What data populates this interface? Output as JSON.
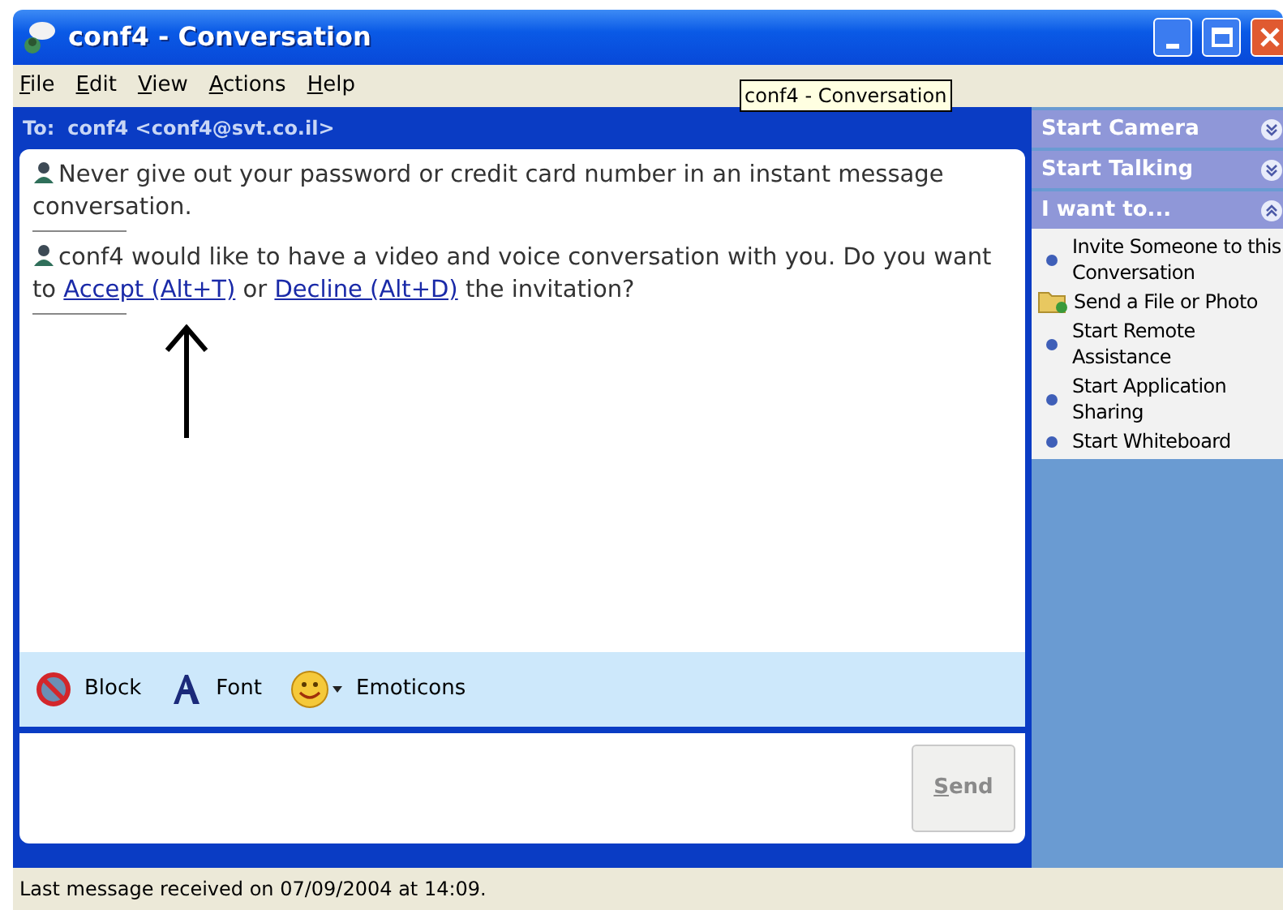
{
  "window": {
    "title": "conf4 - Conversation"
  },
  "menu": [
    {
      "key": "F",
      "rest": "ile"
    },
    {
      "key": "E",
      "rest": "dit"
    },
    {
      "key": "V",
      "rest": "iew"
    },
    {
      "key": "A",
      "rest": "ctions"
    },
    {
      "key": "H",
      "rest": "elp"
    }
  ],
  "tooltip": "conf4 - Conversation",
  "to": {
    "label": "To:",
    "contact": "conf4 <conf4@svt.co.il>"
  },
  "messages": [
    {
      "kind": "warning",
      "text": "Never give out your password or credit card number in an instant message conversation."
    },
    {
      "kind": "invite",
      "before": "conf4 would like to have a video and voice conversation with you. Do you want to",
      "accept": "Accept (Alt+T)",
      "middle": "or",
      "decline": "Decline (Alt+D)",
      "after": "the invitation?"
    }
  ],
  "toolbar": [
    {
      "kind": "block",
      "label": "Block"
    },
    {
      "kind": "font",
      "label": "Font"
    },
    {
      "kind": "emoticons",
      "label": "Emoticons"
    }
  ],
  "send_button": {
    "key": "S",
    "rest": "end",
    "disabled": true
  },
  "side_panel": [
    {
      "title": "Start Camera",
      "expanded": false
    },
    {
      "title": "Start Talking",
      "expanded": false
    },
    {
      "title": "I want to...",
      "expanded": true,
      "items": [
        {
          "kind": "bullet",
          "label": "Invite Someone to this Conversation"
        },
        {
          "kind": "file",
          "label": "Send a File or Photo"
        },
        {
          "kind": "bullet",
          "label": "Start Remote Assistance"
        },
        {
          "kind": "bullet",
          "label": "Start Application Sharing"
        },
        {
          "kind": "bullet",
          "label": "Start Whiteboard"
        }
      ]
    }
  ],
  "status_bar": "Last message received on 07/09/2004 at 14:09."
}
